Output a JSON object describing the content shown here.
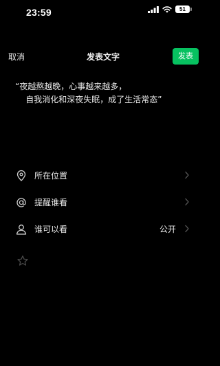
{
  "status_bar": {
    "time": "23:59",
    "battery": "51"
  },
  "nav": {
    "cancel_label": "取消",
    "title": "发表文字",
    "publish_label": "发表"
  },
  "post": {
    "text": "“夜越熬越晚，心事越来越多，\n    自我消化和深夜失眠，成了生活常态”"
  },
  "options": {
    "location_label": "所在位置",
    "remind_label": "提醒谁看",
    "visibility_label": "谁可以看",
    "visibility_value": "公开"
  },
  "colors": {
    "accent": "#07c160",
    "background": "#000000",
    "icon": "#cfcfcf",
    "chevron": "#5a5a5a"
  },
  "icons": {
    "location": "location-pin-icon",
    "remind": "at-sign-icon",
    "visibility": "person-icon",
    "favorite": "star-icon"
  }
}
